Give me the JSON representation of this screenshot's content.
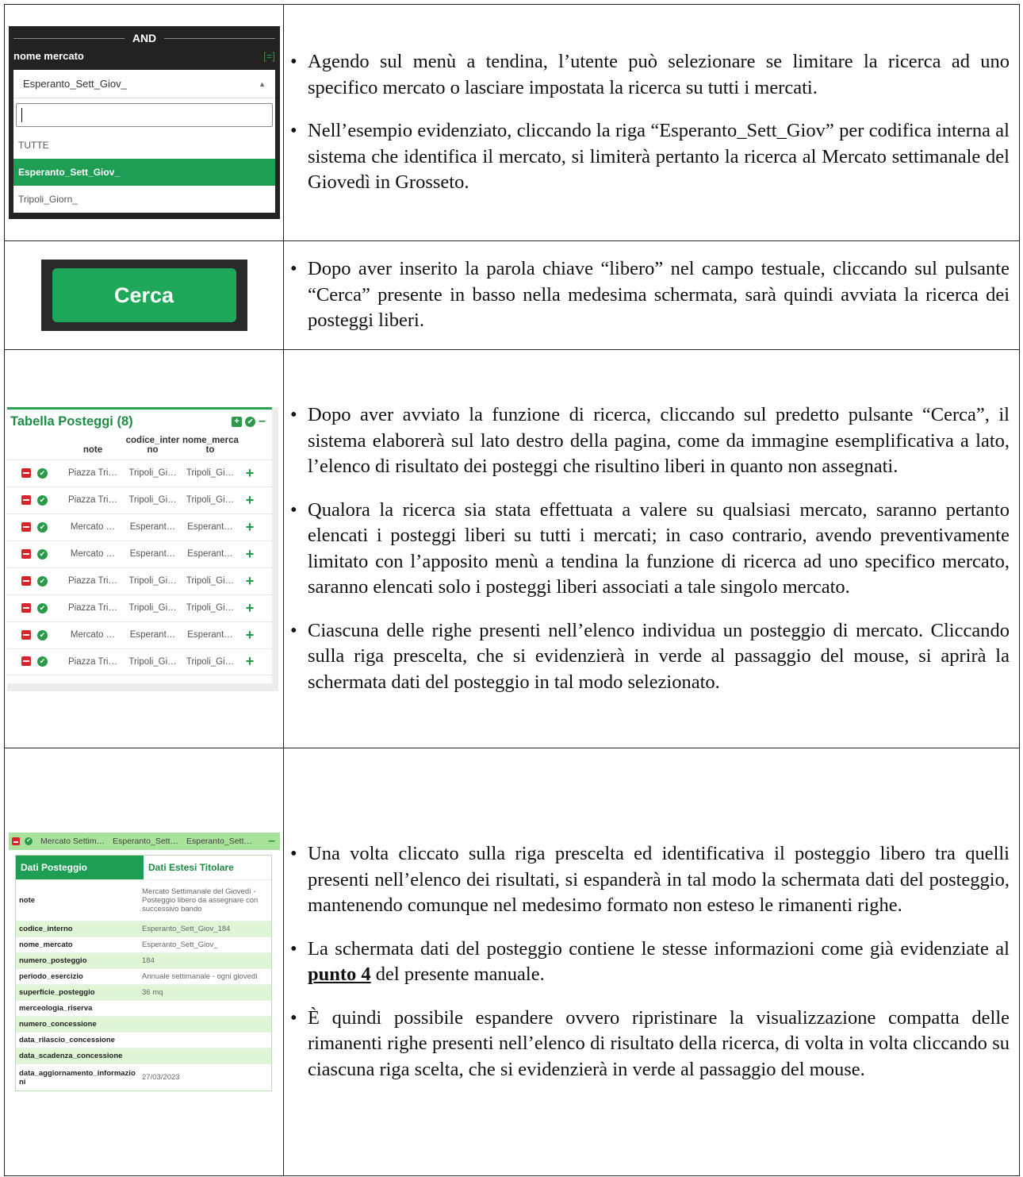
{
  "row1": {
    "and_label": "AND",
    "field_label": "nome mercato",
    "eq_badge": "[=]",
    "selected_value": "Esperanto_Sett_Giov_",
    "options": [
      "TUTTE",
      "Esperanto_Sett_Giov_",
      "Tripoli_Giorn_"
    ],
    "bullets": [
      "Agendo sul menù a tendina, l’utente può selezionare se limitare la ricerca ad uno specifico mercato o lasciare impostata la ricerca su tutti i mercati.",
      "Nell’esempio evidenziato, cliccando la riga “Esperanto_Sett_Giov” per codifica interna al sistema che identifica il mercato, si limiterà pertanto la ricerca al Mercato settimanale del Giovedì in Grosseto."
    ]
  },
  "row2": {
    "button_label": "Cerca",
    "bullets": [
      "Dopo aver inserito la parola chiave “libero” nel campo testuale, cliccando sul pulsante “Cerca” presente in basso nella medesima schermata, sarà quindi avviata la ricerca dei posteggi liberi."
    ]
  },
  "row3": {
    "table_title": "Tabella Posteggi (8)",
    "columns": [
      "note",
      "codice_inter no",
      "nome_merca to"
    ],
    "rows": [
      [
        "Piazza Tri…",
        "Tripoli_Gi…",
        "Tripoli_Gi…"
      ],
      [
        "Piazza Tri…",
        "Tripoli_Gi…",
        "Tripoli_Gi…"
      ],
      [
        "Mercato …",
        "Esperant…",
        "Esperant…"
      ],
      [
        "Mercato …",
        "Esperant…",
        "Esperant…"
      ],
      [
        "Piazza Tri…",
        "Tripoli_Gi…",
        "Tripoli_Gi…"
      ],
      [
        "Piazza Tri…",
        "Tripoli_Gi…",
        "Tripoli_Gi…"
      ],
      [
        "Mercato …",
        "Esperant…",
        "Esperant…"
      ],
      [
        "Piazza Tri…",
        "Tripoli_Gi…",
        "Tripoli_Gi…"
      ]
    ],
    "bullets": [
      "Dopo aver avviato la funzione di ricerca, cliccando sul predetto pulsante “Cerca”, il sistema elaborerà sul lato destro della pagina, come da immagine esemplificativa a lato, l’elenco di risultato dei posteggi che risultino liberi in quanto non assegnati.",
      "Qualora la ricerca sia stata effettuata a valere su qualsiasi mercato, saranno pertanto elencati i posteggi liberi su tutti i mercati; in caso contrario, avendo preventivamente limitato con l’apposito menù a tendina la funzione di ricerca ad uno specifico mercato, saranno elencati solo i posteggi liberi associati a tale singolo mercato.",
      "Ciascuna delle righe presenti nell’elenco individua un posteggio di mercato. Cliccando sulla riga prescelta, che si evidenzierà in verde al passaggio del mouse, si aprirà la schermata dati del posteggio in tal modo selezionato."
    ]
  },
  "row4": {
    "top_row": [
      "Mercato Settim…",
      "Esperanto_Sett…",
      "Esperanto_Sett…"
    ],
    "tab_active": "Dati Posteggio",
    "tab_other": "Dati Estesi Titolare",
    "fields": [
      {
        "k": "note",
        "v": "Mercato Settimanale del Giovedì - Posteggio libero da assegnare con successivo bando"
      },
      {
        "k": "codice_interno",
        "v": "Esperanto_Sett_Giov_184"
      },
      {
        "k": "nome_mercato",
        "v": "Esperanto_Sett_Giov_"
      },
      {
        "k": "numero_posteggio",
        "v": "184"
      },
      {
        "k": "periodo_esercizio",
        "v": "Annuale settimanale - ogni giovedì"
      },
      {
        "k": "superficie_posteggio",
        "v": "36 mq"
      },
      {
        "k": "merceologia_riserva",
        "v": ""
      },
      {
        "k": "numero_concessione",
        "v": ""
      },
      {
        "k": "data_rilascio_concessione",
        "v": ""
      },
      {
        "k": "data_scadenza_concessione",
        "v": ""
      },
      {
        "k": "data_aggiornamento_informazioni",
        "v": "27/03/2023"
      }
    ],
    "bullet1": "Una volta cliccato sulla riga prescelta ed identificativa il posteggio libero tra quelli presenti nell’elenco dei risultati, si espanderà in tal modo la schermata dati del posteggio, mantenendo comunque nel medesimo formato non esteso le rimanenti righe.",
    "bullet2_a": "La schermata dati del posteggio contiene le stesse informazioni come già evidenziate al ",
    "bullet2_link": "punto 4",
    "bullet2_b": " del presente manuale.",
    "bullet3": "È quindi possibile espandere ovvero ripristinare la visualizzazione compatta delle rimanenti righe presenti nell’elenco di risultato della ricerca, di volta in volta cliccando su ciascuna riga scelta, che si evidenzierà in verde al passaggio del mouse."
  }
}
